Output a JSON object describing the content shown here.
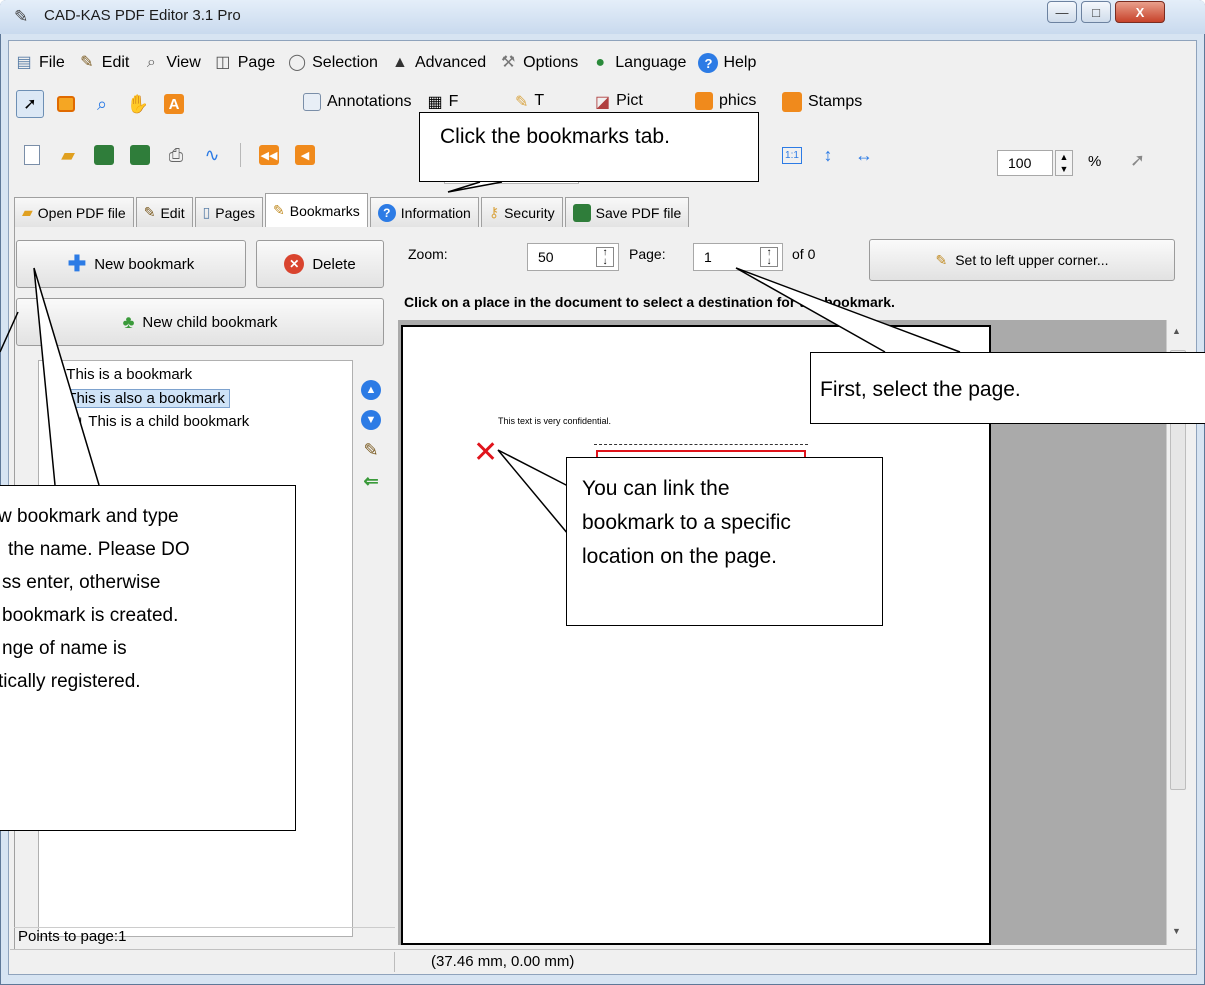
{
  "window": {
    "title": "CAD-KAS PDF Editor 3.1 Pro",
    "minimize": "—",
    "maximize": "□",
    "close": "X"
  },
  "menu": [
    "File",
    "Edit",
    "View",
    "Page",
    "Selection",
    "Advanced",
    "Options",
    "Language",
    "Help"
  ],
  "toolbar2": {
    "annotations": "Annotations",
    "forms_partial": "F",
    "text_partial": "T",
    "pictures_partial": "Pict",
    "graphics_partial": "phics",
    "stamps": "Stamps"
  },
  "toolbar3": {
    "zoom_value": "100",
    "zoom_unit": "%"
  },
  "tabs": [
    "Open PDF file",
    "Edit",
    "Pages",
    "Bookmarks",
    "Information",
    "Security",
    "Save PDF file"
  ],
  "left": {
    "new_bookmark": "New bookmark",
    "delete": "Delete",
    "new_child": "New child bookmark",
    "tree": [
      "This is a bookmark",
      "This is also a bookmark",
      "This is a child bookmark"
    ],
    "points_to": "Points to page:1"
  },
  "right": {
    "zoom_label": "Zoom:",
    "zoom_value": "50",
    "page_label": "Page:",
    "page_value": "1",
    "of_label": "of 0",
    "set_corner": "Set to left upper corner...",
    "instruction": "Click on a place in the document to select a destination for the bookmark.",
    "page_text": "This text is very confidential."
  },
  "status": {
    "coords": "(37.46 mm, 0.00 mm)"
  },
  "callouts": {
    "tab": "Click the bookmarks tab.",
    "page": "First, select the page.",
    "link": [
      "You can link the",
      "bookmark to a specific",
      "location on the page."
    ],
    "new": [
      "w bookmark and type",
      "the name. Please DO",
      "ss enter, otherwise",
      "bookmark is created.",
      "nge of name is",
      "tically registered."
    ]
  },
  "colors": {
    "accent": "#2c7be5",
    "selection": "#cfe3f7",
    "close": "#c7422a",
    "marker": "#e0141c"
  }
}
